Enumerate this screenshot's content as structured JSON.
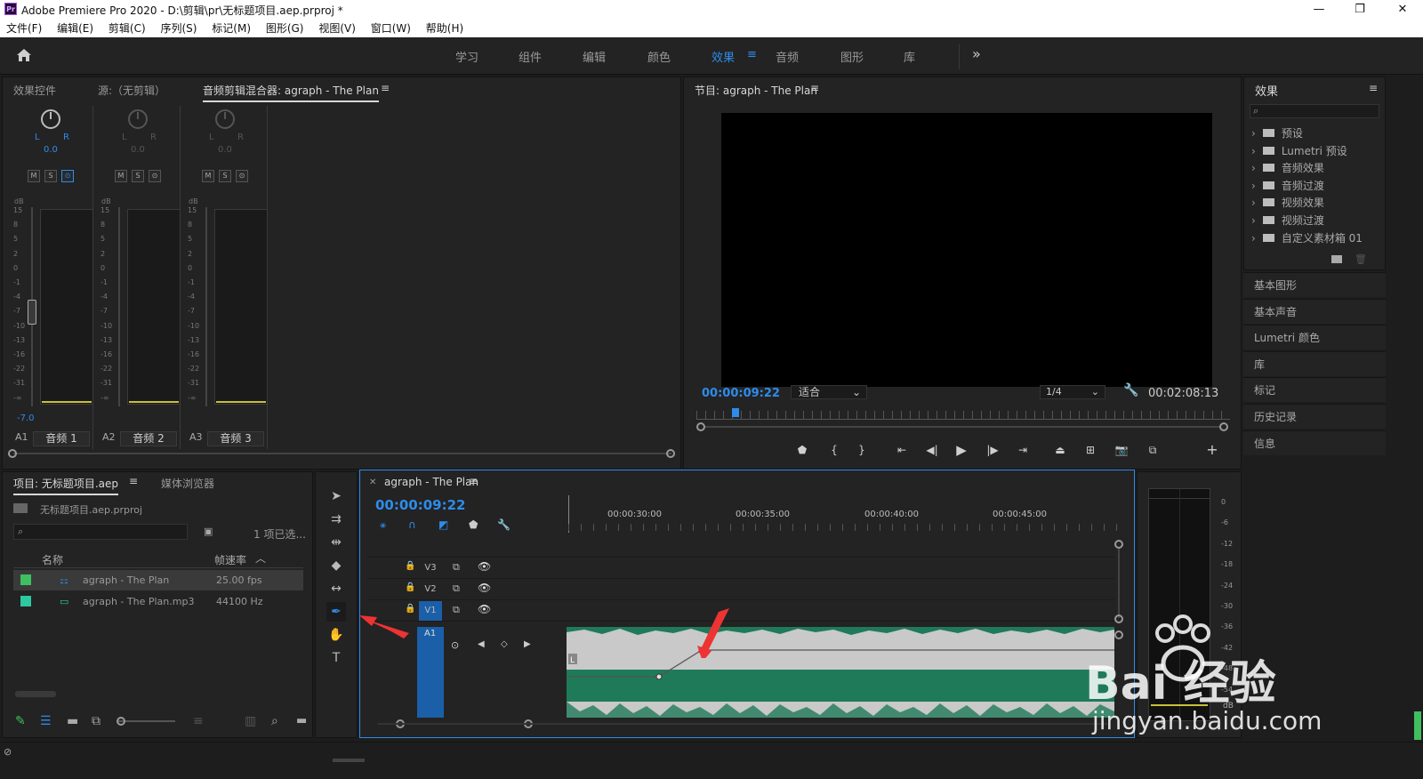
{
  "window": {
    "logo": "Pr",
    "title": "Adobe Premiere Pro 2020 - D:\\剪辑\\pr\\无标题项目.aep.prproj *",
    "controls": [
      "—",
      "❐",
      "✕"
    ]
  },
  "menu": [
    "文件(F)",
    "编辑(E)",
    "剪辑(C)",
    "序列(S)",
    "标记(M)",
    "图形(G)",
    "视图(V)",
    "窗口(W)",
    "帮助(H)"
  ],
  "workspaces": {
    "tabs": [
      "学习",
      "组件",
      "编辑",
      "颜色",
      "效果",
      "音频",
      "图形",
      "库"
    ],
    "active": "效果",
    "more": "»"
  },
  "source_panel": {
    "tabs": [
      "效果控件",
      "源:（无剪辑）",
      "音频剪辑混合器: agraph - The Plan"
    ],
    "active_index": 2,
    "channels": [
      {
        "id": "A1",
        "name": "音频 1",
        "value": "0.0",
        "level": "-7.0",
        "active": true
      },
      {
        "id": "A2",
        "name": "音频 2",
        "value": "0.0",
        "level": "",
        "active": false
      },
      {
        "id": "A3",
        "name": "音频 3",
        "value": "0.0",
        "level": "",
        "active": false
      }
    ],
    "buttons": [
      "M",
      "S",
      "⊙"
    ],
    "lr": "L",
    "r": "R",
    "db": "dB",
    "scale": [
      "15",
      "8",
      "5",
      "2",
      "0",
      "-1",
      "-4",
      "-7",
      "-10",
      "-13",
      "-16",
      "-22",
      "-31",
      "-∞"
    ]
  },
  "program_monitor": {
    "tab": "节目: agraph - The Plan",
    "timecode": "00:00:09:22",
    "fit": "适合",
    "resolution": "1/4",
    "duration": "00:02:08:13"
  },
  "effects_panel": {
    "title": "效果",
    "items": [
      "预设",
      "Lumetri 预设",
      "音频效果",
      "音频过渡",
      "视频效果",
      "视频过渡",
      "自定义素材箱 01"
    ],
    "side_panels": [
      "基本图形",
      "基本声音",
      "Lumetri 颜色",
      "库",
      "标记",
      "历史记录",
      "信息"
    ]
  },
  "project_panel": {
    "tabs": [
      "项目: 无标题项目.aep",
      "媒体浏览器"
    ],
    "file": "无标题项目.aep.prproj",
    "selection": "1 项已选...",
    "columns": {
      "name": "名称",
      "fps": "帧速率"
    },
    "items": [
      {
        "name": "agraph - The Plan",
        "rate": "25.00 fps",
        "color": "#3fbf5f"
      },
      {
        "name": "agraph - The Plan.mp3",
        "rate": "44100 Hz",
        "color": "#2ec8a0"
      }
    ]
  },
  "timeline": {
    "tab": "agraph - The Plan",
    "timecode": "00:00:09:22",
    "ruler": [
      "00:00:30:00",
      "00:00:35:00",
      "00:00:40:00",
      "00:00:45:00"
    ],
    "tracks": [
      "V3",
      "V2",
      "V1",
      "A1"
    ]
  },
  "meters": {
    "scale": [
      "0",
      "-6",
      "-12",
      "-18",
      "-24",
      "-30",
      "-36",
      "-42",
      "-48",
      "-54"
    ],
    "unit": "dB",
    "solo": "S"
  },
  "watermark": {
    "text": "Bai 经验",
    "sub": "jingyan.baidu.com"
  },
  "colors": {
    "accent": "#2d8ceb",
    "waveform": "#1f7a5a",
    "clip": "#c9c9c9"
  }
}
